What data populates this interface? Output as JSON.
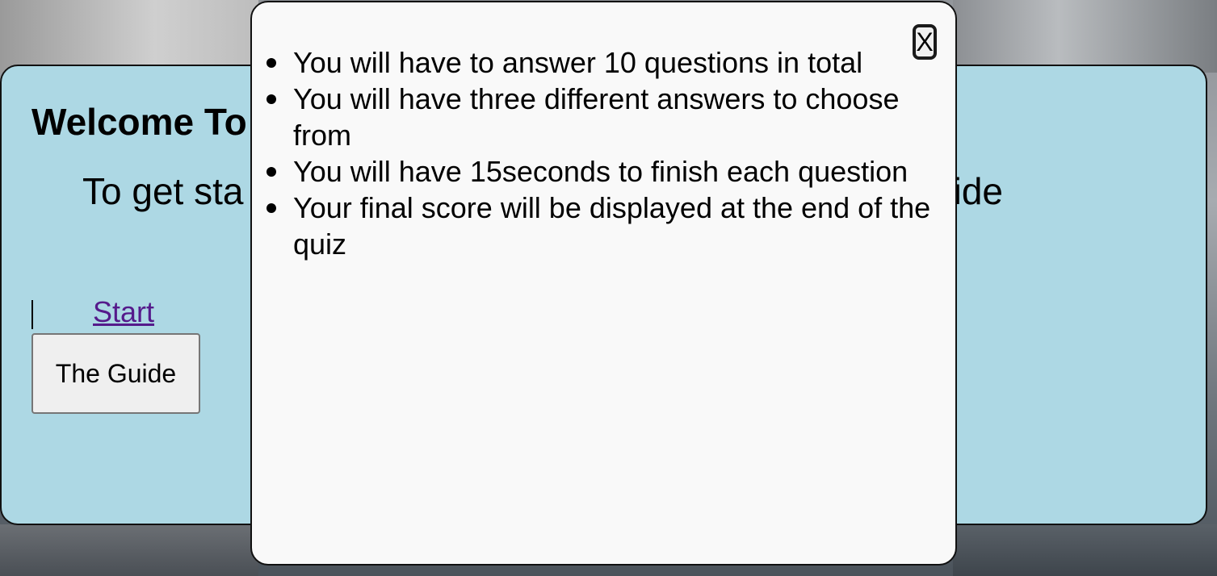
{
  "welcome": {
    "title": "Welcome To",
    "subtitle_left": "To get sta",
    "subtitle_right": "ide",
    "start_link": "Start",
    "guide_button": "The Guide"
  },
  "modal": {
    "close_label": "X",
    "rules": [
      "You will have to answer 10 questions in total",
      "You will have three different answers to choose from",
      "You will have 15seconds to finish each question",
      "Your final score will be displayed at the end of the quiz"
    ]
  },
  "colors": {
    "card_background": "#add8e4",
    "modal_background": "#f9f9f9",
    "link_color": "#551a8b"
  }
}
